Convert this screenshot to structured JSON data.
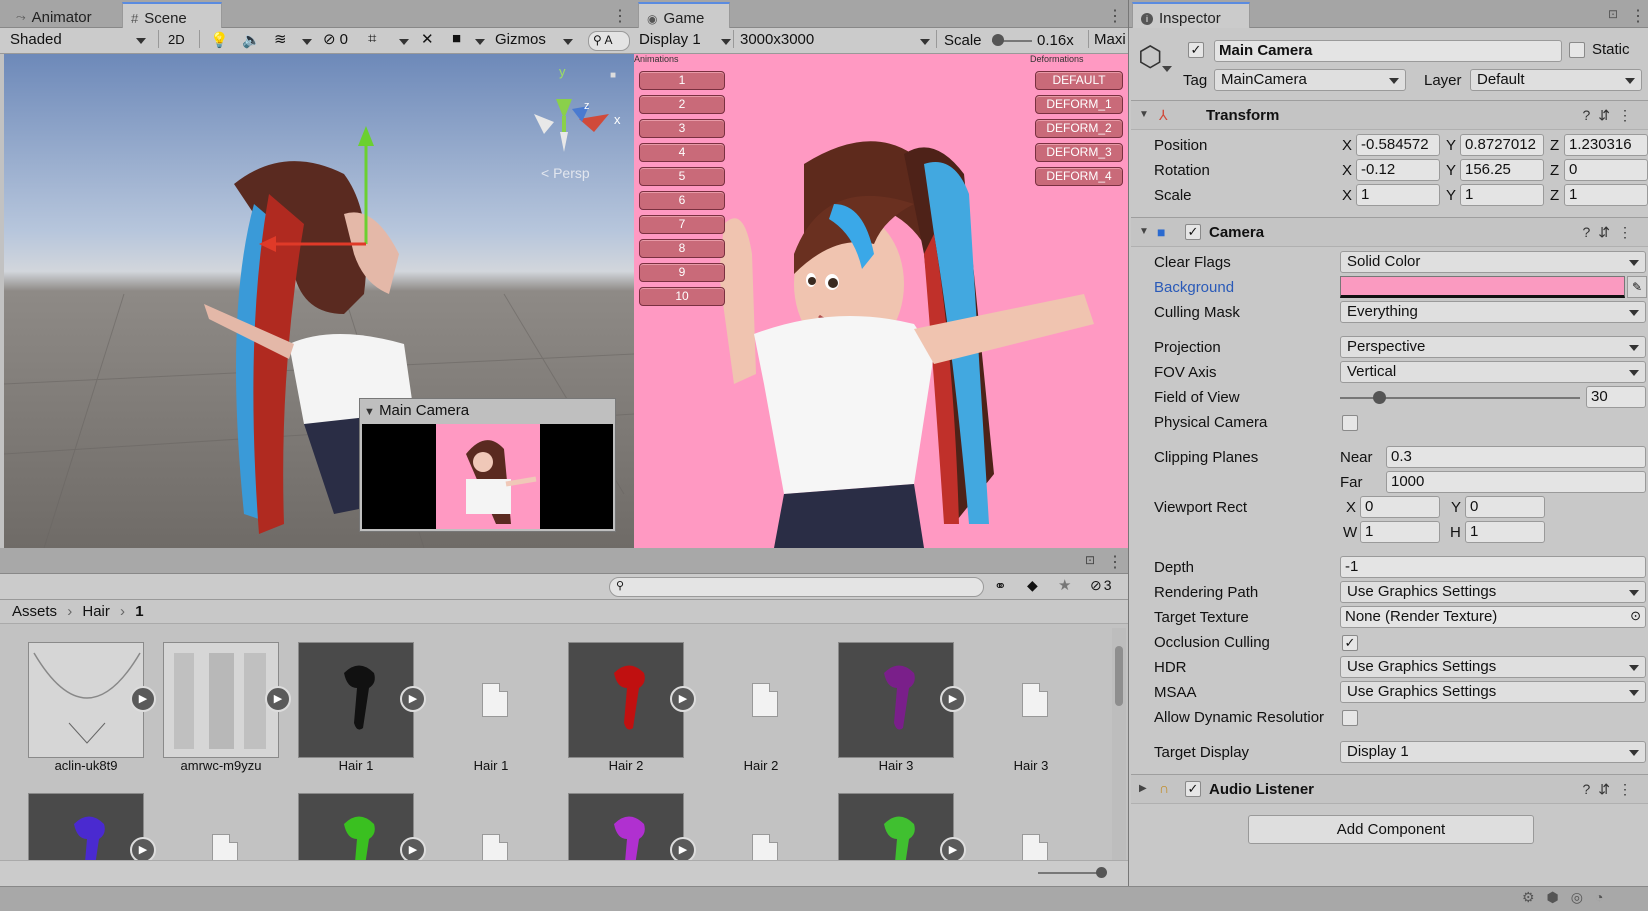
{
  "scene_panel": {
    "tabs": [
      {
        "label": "Animator",
        "icon": "animator-icon"
      },
      {
        "label": "Scene",
        "icon": "grid-icon"
      }
    ],
    "toolbar": {
      "shading": "Shaded",
      "mode_2d": "2D",
      "hidden_count": "0",
      "gizmos": "Gizmos",
      "search_glyph": "A"
    },
    "persp_label": "< Persp",
    "gizmo_axes": {
      "x": "x",
      "y": "y",
      "z": "z"
    },
    "camera_preview_title": "Main Camera"
  },
  "game_panel": {
    "tab": "Game",
    "toolbar": {
      "display": "Display 1",
      "resolution": "3000x3000",
      "scale_label": "Scale",
      "scale_value": "0.16x",
      "maximize": "Maxi"
    },
    "background_color": "#ff99c2",
    "animations_label": "Animations",
    "animation_buttons": [
      "1",
      "2",
      "3",
      "4",
      "5",
      "6",
      "7",
      "8",
      "9",
      "10"
    ],
    "deformations_label": "Deformations",
    "deform_buttons": [
      "DEFAULT",
      "DEFORM_1",
      "DEFORM_2",
      "DEFORM_3",
      "DEFORM_4"
    ]
  },
  "project_panel": {
    "hidden_count": "3",
    "breadcrumb": [
      "Assets",
      "Hair",
      "1"
    ],
    "assets_row1": [
      {
        "label": "aclin-uk8t9",
        "type": "texture"
      },
      {
        "label": "amrwc-m9yzu",
        "type": "texture"
      },
      {
        "label": "Hair 1",
        "type": "model",
        "color": "#111111"
      },
      {
        "label": "Hair 1",
        "type": "file"
      },
      {
        "label": "Hair 2",
        "type": "model",
        "color": "#c01010"
      },
      {
        "label": "Hair 2",
        "type": "file"
      },
      {
        "label": "Hair 3",
        "type": "model",
        "color": "#7a1f8a"
      },
      {
        "label": "Hair 3",
        "type": "file"
      }
    ],
    "assets_row2": [
      {
        "type": "model",
        "color": "#4a2ad0"
      },
      {
        "type": "file"
      },
      {
        "type": "model",
        "color": "#3ac020"
      },
      {
        "type": "file"
      },
      {
        "type": "model",
        "color": "#b030d0"
      },
      {
        "type": "file"
      },
      {
        "type": "model",
        "color": "#40c030"
      },
      {
        "type": "file"
      }
    ]
  },
  "inspector": {
    "tab": "Inspector",
    "object_name": "Main Camera",
    "static_label": "Static",
    "tag_label": "Tag",
    "tag_value": "MainCamera",
    "layer_label": "Layer",
    "layer_value": "Default",
    "transform": {
      "title": "Transform",
      "position_label": "Position",
      "position": {
        "x": "-0.584572",
        "y": "0.8727012",
        "z": "1.230316"
      },
      "rotation_label": "Rotation",
      "rotation": {
        "x": "-0.12",
        "y": "156.25",
        "z": "0"
      },
      "scale_label": "Scale",
      "scale": {
        "x": "1",
        "y": "1",
        "z": "1"
      }
    },
    "camera": {
      "title": "Camera",
      "clear_flags_label": "Clear Flags",
      "clear_flags": "Solid Color",
      "background_label": "Background",
      "background_color": "#fa9ac0",
      "culling_mask_label": "Culling Mask",
      "culling_mask": "Everything",
      "projection_label": "Projection",
      "projection": "Perspective",
      "fov_axis_label": "FOV Axis",
      "fov_axis": "Vertical",
      "fov_label": "Field of View",
      "fov": "30",
      "fov_range": [
        1,
        179
      ],
      "physical_label": "Physical Camera",
      "clipping_label": "Clipping Planes",
      "near_label": "Near",
      "near": "0.3",
      "far_label": "Far",
      "far": "1000",
      "viewport_label": "Viewport Rect",
      "vp": {
        "x": "0",
        "y": "0",
        "w": "1",
        "h": "1"
      },
      "depth_label": "Depth",
      "depth": "-1",
      "rendering_path_label": "Rendering Path",
      "rendering_path": "Use Graphics Settings",
      "target_texture_label": "Target Texture",
      "target_texture": "None (Render Texture)",
      "occlusion_label": "Occlusion Culling",
      "hdr_label": "HDR",
      "hdr": "Use Graphics Settings",
      "msaa_label": "MSAA",
      "msaa": "Use Graphics Settings",
      "dynres_label": "Allow Dynamic Resolutior",
      "target_display_label": "Target Display",
      "target_display": "Display 1"
    },
    "audio_listener": {
      "title": "Audio Listener"
    },
    "add_component": "Add Component"
  },
  "axis_labels": {
    "x": "X",
    "y": "Y",
    "z": "Z",
    "w": "W",
    "h": "H"
  }
}
